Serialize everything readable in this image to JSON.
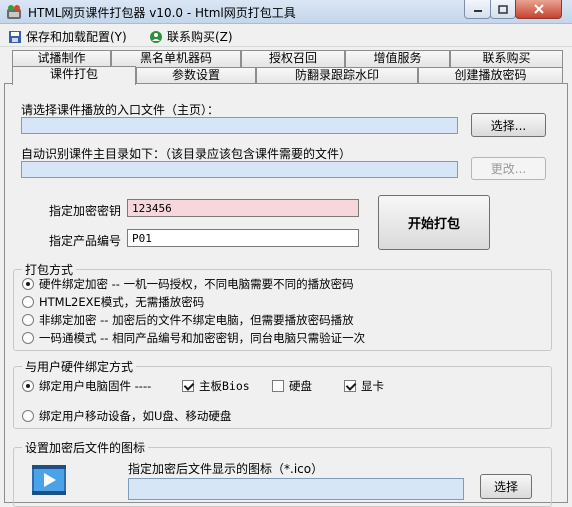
{
  "window": {
    "title": "HTML网页课件打包器 v10.0 - Html网页打包工具"
  },
  "menu": {
    "save_label": "保存和加载配置(Y)",
    "contact_label": "联系购买(Z)"
  },
  "tabs_row1": [
    {
      "label": "试播制作"
    },
    {
      "label": "黑名单机器码"
    },
    {
      "label": "授权召回"
    },
    {
      "label": "增值服务"
    },
    {
      "label": "联系购买"
    }
  ],
  "tabs_row2": [
    {
      "label": "课件打包",
      "active": true
    },
    {
      "label": "参数设置"
    },
    {
      "label": "防翻录跟踪水印"
    },
    {
      "label": "创建播放密码"
    }
  ],
  "main": {
    "entry_label": "请选择课件播放的入口文件（主页）：",
    "entry_value": "",
    "select_button": "选择...",
    "dir_label": "自动识别课件主目录如下：（该目录应该包含课件需要的文件）",
    "dir_value": "",
    "change_button": "更改...",
    "key_label": "指定加密密钥",
    "key_value": "123456",
    "product_label": "指定产品编号",
    "product_value": "P01",
    "start_button": "开始打包"
  },
  "pack_mode": {
    "title": "打包方式",
    "options": [
      {
        "label": "硬件绑定加密 -- 一机一码授权，不同电脑需要不同的播放密码",
        "checked": true
      },
      {
        "label": "HTML2EXE模式，无需播放密码",
        "checked": false
      },
      {
        "label": "非绑定加密 -- 加密后的文件不绑定电脑，但需要播放密码播放",
        "checked": false
      },
      {
        "label": "一码通模式 -- 相同产品编号和加密密钥，同台电脑只需验证一次",
        "checked": false
      }
    ]
  },
  "binding": {
    "title": "与用户硬件绑定方式",
    "pc_option": "绑定用户电脑固件 ----",
    "pc_checked": true,
    "bios_label": "主板Bios",
    "bios_checked": true,
    "disk_label": "硬盘",
    "disk_checked": false,
    "gpu_label": "显卡",
    "gpu_checked": true,
    "mobile_option": "绑定用户移动设备，如U盘、移动硬盘",
    "mobile_checked": false
  },
  "icon_section": {
    "title": "设置加密后文件的图标",
    "icon_label": "指定加密后文件显示的图标（*.ico）",
    "icon_value": "",
    "select_button": "选择"
  },
  "colors": {
    "field_blue": "#d6e6f6",
    "field_pink": "#f6d8dc",
    "close_red": "#c6432f"
  }
}
